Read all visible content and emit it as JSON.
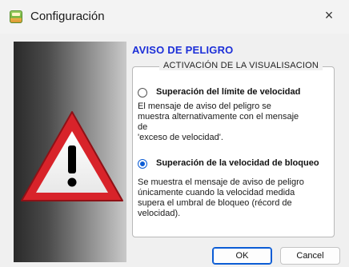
{
  "window": {
    "title": "Configuración",
    "close_glyph": "×"
  },
  "heading": "AVISO DE PELIGRO",
  "group": {
    "legend": "ACTIVACIÓN DE LA VISUALISACION",
    "options": [
      {
        "label": "Superación del límite de velocidad",
        "selected": false,
        "desc_lines": [
          "El mensaje de aviso del peligro se",
          "muestra alternativamente con el mensaje de",
          "'exceso de velocidad'."
        ]
      },
      {
        "label": "Superación de la velocidad de bloqueo",
        "selected": true,
        "desc_lines": [
          "Se muestra el mensaje de aviso de peligro",
          "únicamente cuando la velocidad medida",
          "supera el umbral de bloqueo (récord de",
          "velocidad)."
        ]
      }
    ]
  },
  "buttons": {
    "ok": "OK",
    "cancel": "Cancel"
  },
  "icons": {
    "app": "app-icon",
    "close": "close-icon",
    "warning": "warning-triangle-icon",
    "radio_off": "radio-unselected-icon",
    "radio_on": "radio-selected-icon"
  },
  "colors": {
    "heading": "#1c2fd8",
    "accent": "#0b5cd5",
    "warning_red": "#d8232a"
  }
}
